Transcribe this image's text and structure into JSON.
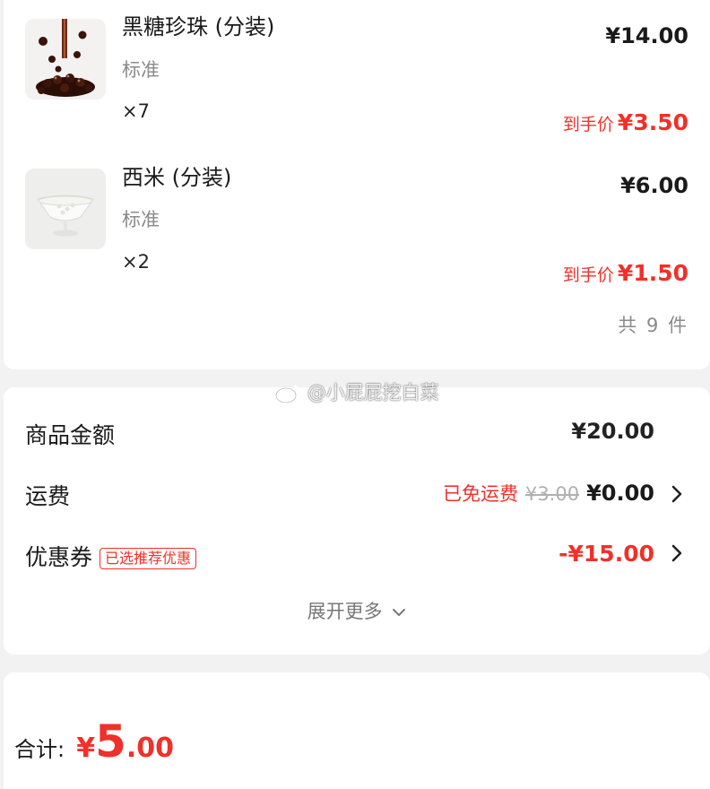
{
  "products": [
    {
      "name": "黑糖珍珠 (分装)",
      "spec": "标准",
      "qty": "×7",
      "price": "¥14.00",
      "final_label": "到手价",
      "final_price": "¥3.50"
    },
    {
      "name": "西米 (分装)",
      "spec": "标准",
      "qty": "×2",
      "price": "¥6.00",
      "final_label": "到手价",
      "final_price": "¥1.50"
    }
  ],
  "count_text": "共 9 件",
  "watermark": "@小屁屁挖白菜",
  "summary": {
    "goods_label": "商品金额",
    "goods_value": "¥20.00",
    "shipping_label": "运费",
    "shipping_free": "已免运费",
    "shipping_original": "¥3.00",
    "shipping_value": "¥0.00",
    "coupon_label": "优惠券",
    "coupon_badge": "已选推荐优惠",
    "coupon_value": "-¥15.00",
    "expand_label": "展开更多"
  },
  "total": {
    "label": "合计:",
    "currency": "¥",
    "integer": "5",
    "decimal": ".00"
  },
  "colors": {
    "accent_red": "#f0302a",
    "background": "#f2f2f2",
    "card": "#ffffff",
    "muted_text": "#8a8a8a"
  }
}
